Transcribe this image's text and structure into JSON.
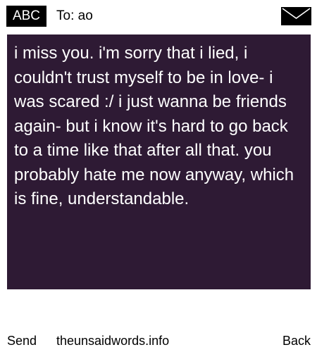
{
  "header": {
    "mode_badge": "ABC",
    "recipient": "To: ao",
    "icon": "envelope-icon"
  },
  "message": {
    "text": "i miss you. i'm sorry that i lied, i couldn't trust myself to be in love- i was scared :/ i just wanna be friends again- but i know it's hard to go back to a time like that after all that. you probably hate me now anyway, which is fine, understandable."
  },
  "footer": {
    "send_label": "Send",
    "site_label": "theunsaidwords.info",
    "back_label": "Back"
  },
  "colors": {
    "message_background": "#2e1a34",
    "message_text": "#ffffff",
    "badge_background": "#000000",
    "page_background": "#ffffff"
  }
}
